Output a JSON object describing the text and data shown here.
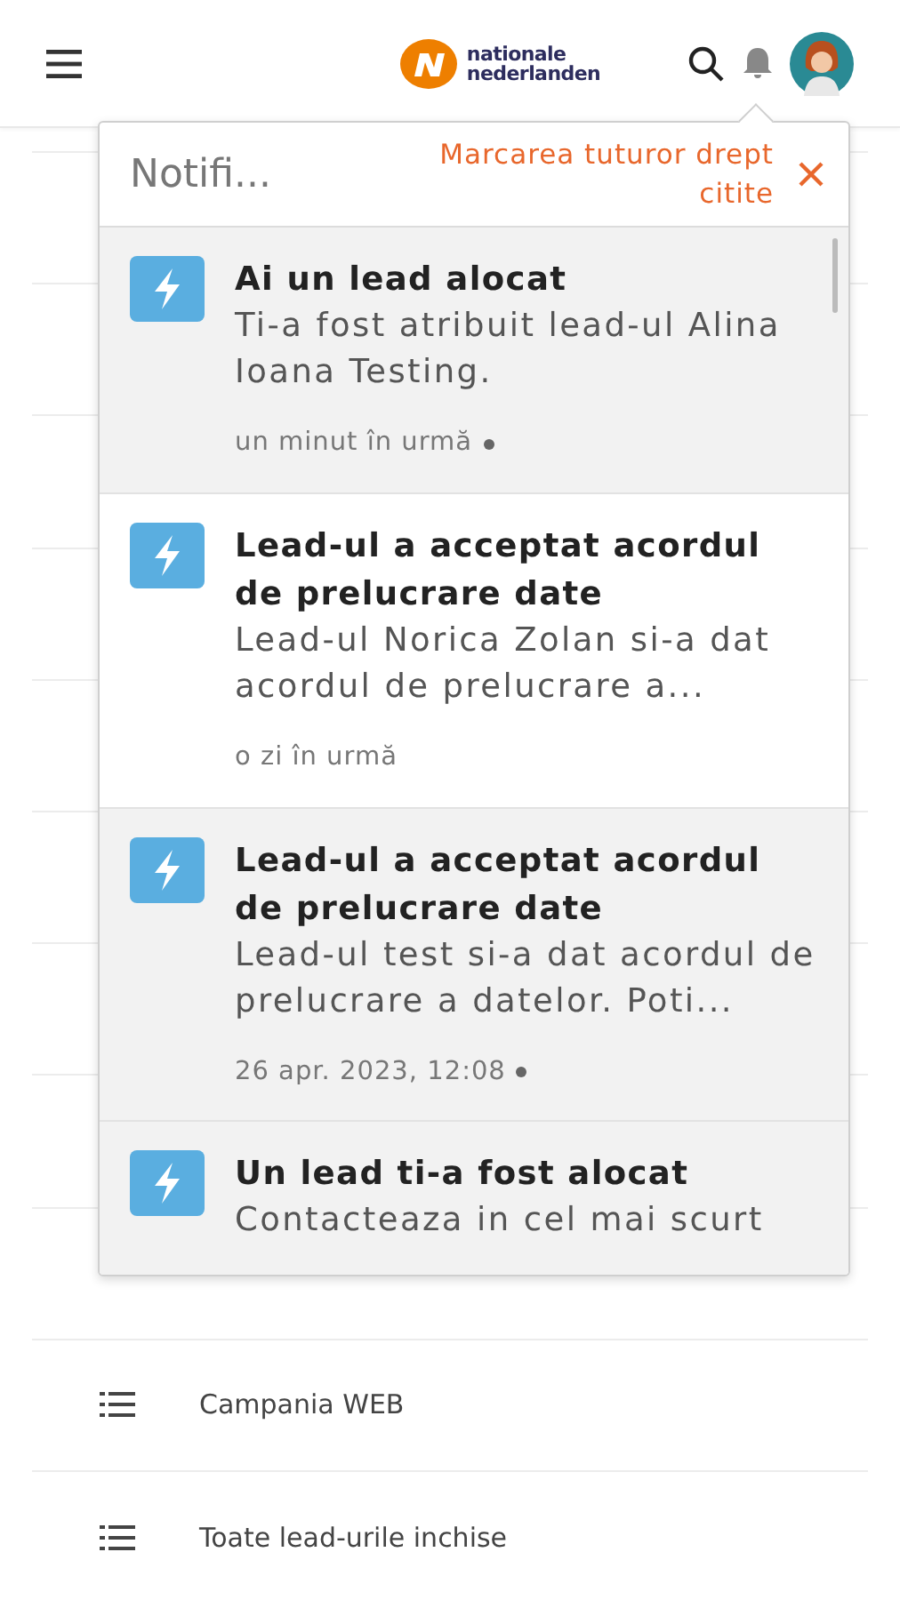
{
  "header": {
    "logo_text": [
      "nationale",
      "nederlanden"
    ]
  },
  "notifications_panel": {
    "title": "Notifi...",
    "mark_all_read": "Marcarea tuturor drept citite",
    "items": [
      {
        "title": "Ai un lead alocat",
        "body": "Ti-a fost atribuit lead-ul Alina Ioana Testing.",
        "time": "un minut în urmă",
        "unread": true
      },
      {
        "title": "Lead-ul a acceptat acordul de prelucrare date",
        "body": "Lead-ul Norica Zolan si-a dat acordul de prelucrare a...",
        "time": "o zi în urmă",
        "unread": false
      },
      {
        "title": "Lead-ul a acceptat acordul de prelucrare date",
        "body": "Lead-ul test si-a dat acordul de prelucrare a datelor. Poti...",
        "time": "26 apr. 2023, 12:08",
        "unread": true
      },
      {
        "title": "Un lead ti-a fost alocat",
        "body": "Contacteaza in cel mai scurt",
        "unread": true
      }
    ]
  },
  "lists": [
    {
      "label": "Campania WEB"
    },
    {
      "label": "Toate lead-urile inchise"
    }
  ]
}
